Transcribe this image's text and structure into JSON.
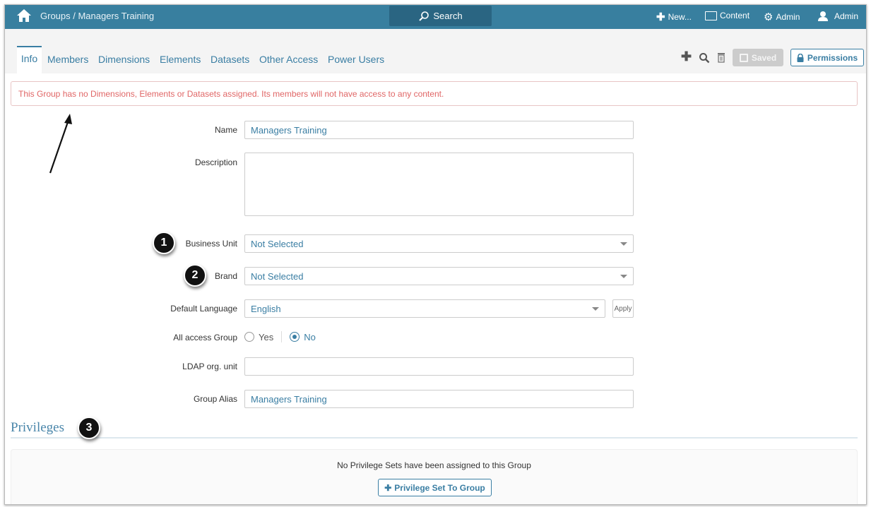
{
  "header": {
    "breadcrumb": "Groups / Managers Training",
    "search_label": "Search",
    "new_label": "New...",
    "content_label": "Content",
    "admin_label": "Admin",
    "user_label": "Admin"
  },
  "tabs": [
    {
      "label": "Info",
      "active": true
    },
    {
      "label": "Members"
    },
    {
      "label": "Dimensions"
    },
    {
      "label": "Elements"
    },
    {
      "label": "Datasets"
    },
    {
      "label": "Other Access"
    },
    {
      "label": "Power Users"
    }
  ],
  "toolbar": {
    "saved_label": "Saved",
    "permissions_label": "Permissions"
  },
  "alert": "This Group has no Dimensions, Elements or Datasets assigned. Its members will not have access to any content.",
  "form": {
    "name": {
      "label": "Name",
      "value": "Managers Training"
    },
    "description": {
      "label": "Description",
      "value": ""
    },
    "business_unit": {
      "label": "Business Unit",
      "value": "Not Selected"
    },
    "brand": {
      "label": "Brand",
      "value": "Not Selected"
    },
    "default_language": {
      "label": "Default Language",
      "value": "English",
      "apply_label": "Apply"
    },
    "all_access": {
      "label": "All access Group",
      "yes": "Yes",
      "no": "No",
      "selected": "No"
    },
    "ldap": {
      "label": "LDAP org. unit",
      "value": ""
    },
    "alias": {
      "label": "Group Alias",
      "value": "Managers Training"
    }
  },
  "privileges": {
    "title": "Privileges",
    "empty_text": "No Privilege Sets have been assigned to this Group",
    "add_label": "Privilege Set To Group"
  },
  "annotations": [
    "1",
    "2",
    "3"
  ],
  "colors": {
    "header": "#387f9f",
    "accent": "#3a7ea3",
    "alert": "#e06666"
  }
}
